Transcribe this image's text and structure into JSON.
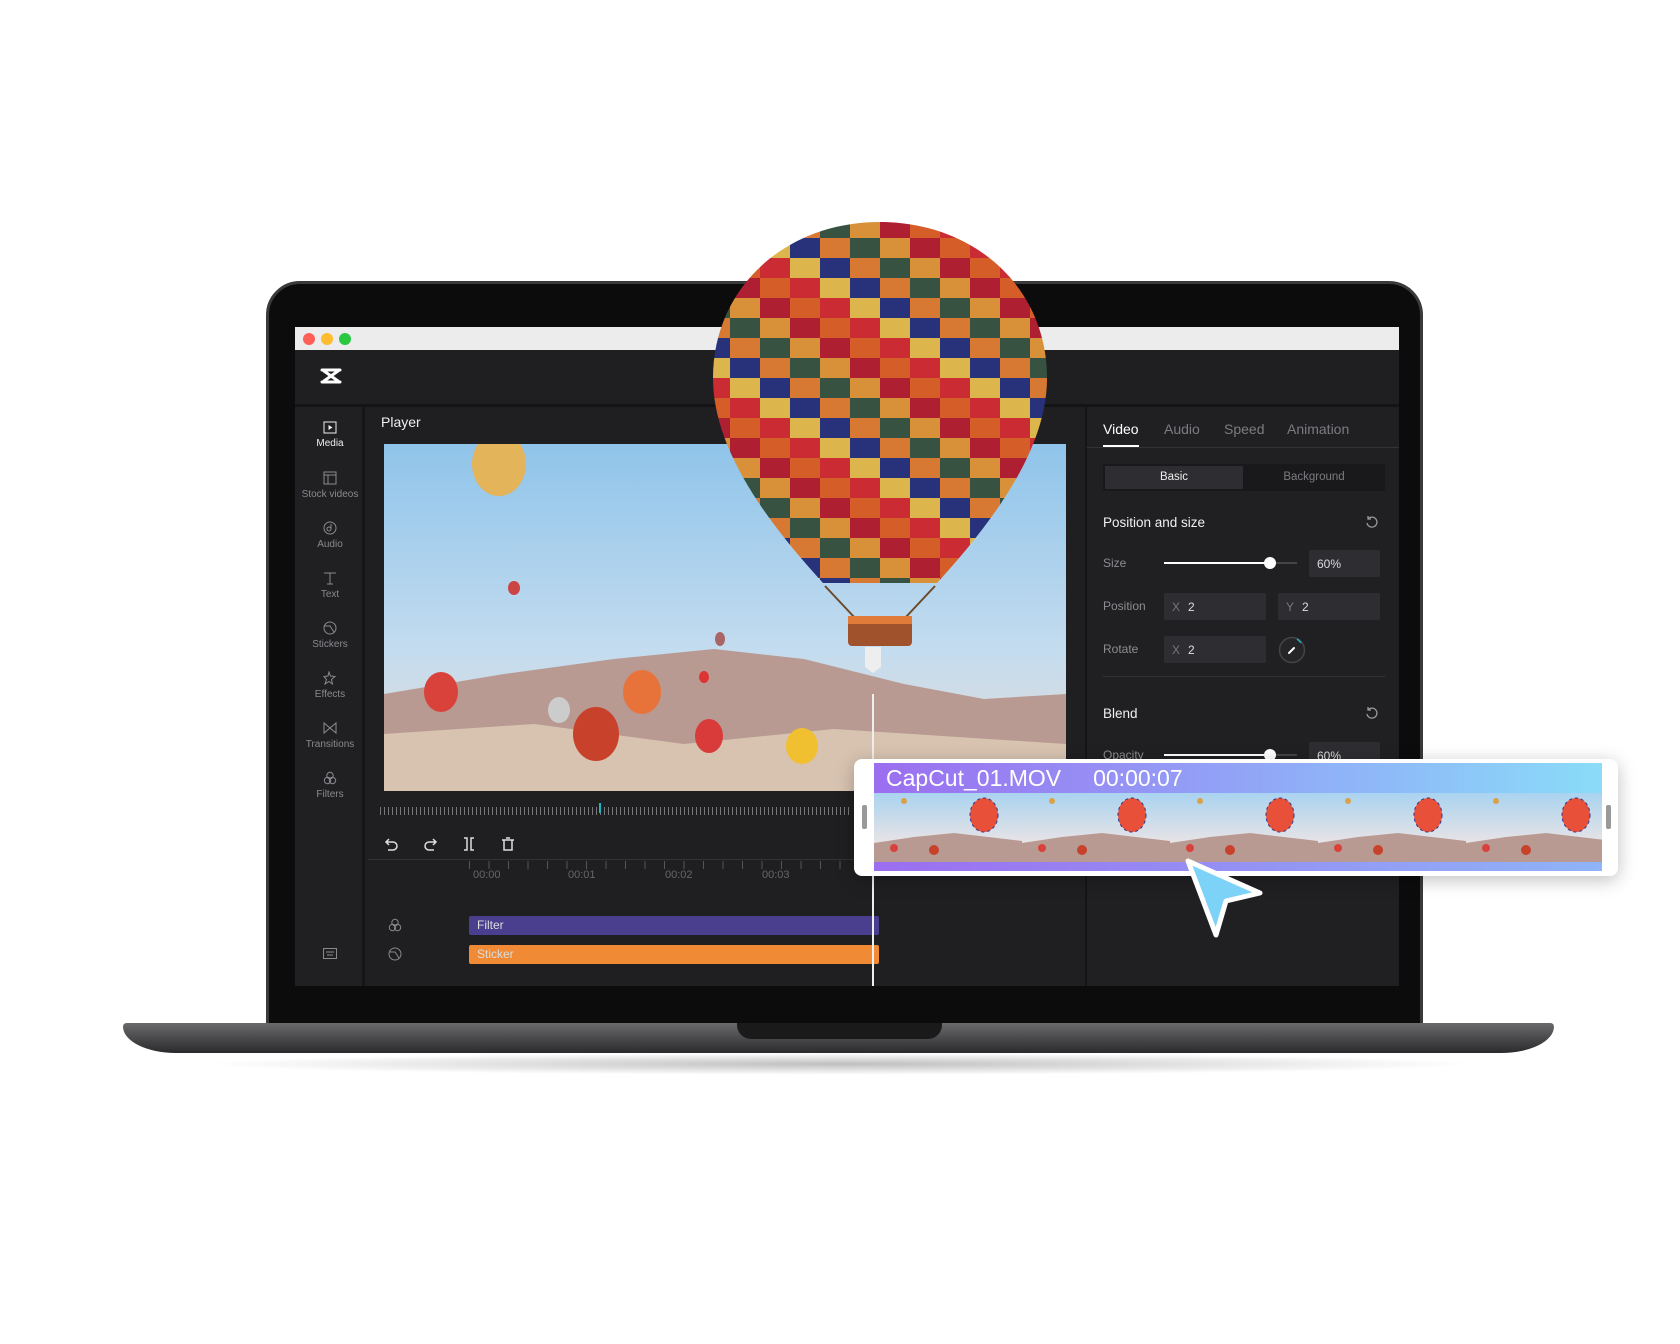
{
  "window": {
    "traffic_lights": [
      "#fe5f57",
      "#febc2e",
      "#28c840"
    ]
  },
  "app": {
    "logo": "capcut-logo"
  },
  "sidebar": {
    "items": [
      {
        "label": "Media",
        "icon": "media-icon",
        "active": true
      },
      {
        "label": "Stock videos",
        "icon": "stock-videos-icon"
      },
      {
        "label": "Audio",
        "icon": "audio-icon"
      },
      {
        "label": "Text",
        "icon": "text-icon"
      },
      {
        "label": "Stickers",
        "icon": "stickers-icon"
      },
      {
        "label": "Effects",
        "icon": "effects-icon"
      },
      {
        "label": "Transitions",
        "icon": "transitions-icon"
      },
      {
        "label": "Filters",
        "icon": "filters-icon"
      }
    ],
    "bottom_icon": "keyboard-icon"
  },
  "player": {
    "title": "Player"
  },
  "toolbar": {
    "undo": "undo-icon",
    "redo": "redo-icon",
    "split": "split-icon",
    "delete": "delete-icon"
  },
  "timeline": {
    "ticks": [
      "00:00",
      "00:01",
      "00:02",
      "00:03"
    ],
    "tracks": [
      {
        "label": "Filter",
        "color": "#4a3f8f",
        "icon": "filters-icon"
      },
      {
        "label": "Sticker",
        "color": "#f08a34",
        "icon": "stickers-icon"
      }
    ]
  },
  "inspector": {
    "tabs": [
      "Video",
      "Audio",
      "Speed",
      "Animation"
    ],
    "active_tab": "Video",
    "segments": [
      "Basic",
      "Background"
    ],
    "active_segment": "Basic",
    "position_section": "Position and size",
    "size_label": "Size",
    "size_value": "60%",
    "size_fraction": 0.8,
    "position_label": "Position",
    "pos_x_axis": "X",
    "pos_x": "2",
    "pos_y_axis": "Y",
    "pos_y": "2",
    "rotate_label": "Rotate",
    "rot_axis": "X",
    "rot_x": "2",
    "blend_section": "Blend",
    "opacity_label": "Opacity",
    "opacity_value": "60%",
    "opacity_fraction": 0.8
  },
  "clip": {
    "name": "CapCut_01.MOV",
    "duration": "00:00:07"
  },
  "colors": {
    "accent": "#8fb4f8",
    "cursor": "#7dd3f7"
  }
}
